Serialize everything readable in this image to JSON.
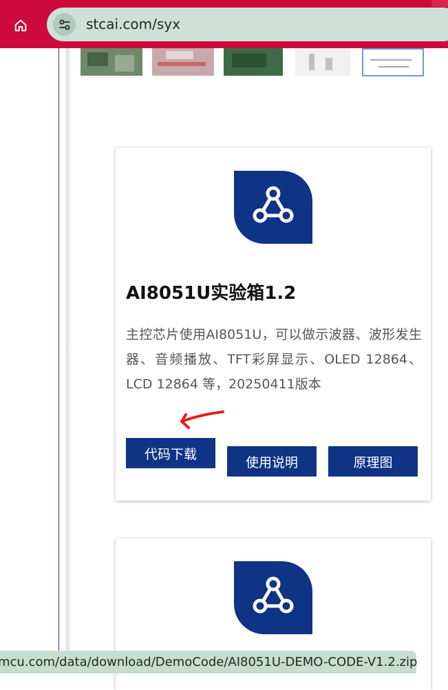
{
  "browser": {
    "url": "stcai.com/syx",
    "home_icon": "home-icon",
    "site_settings_icon": "tune-icon",
    "chrome_color": "#cc0a3c",
    "urlbar_color": "#cfe0d8"
  },
  "cards": [
    {
      "icon": "webhook-icon",
      "title": "AI8051U实验箱1.2",
      "description": "主控芯片使用AI8051U，可以做示波器、波形发生器、音频播放、TFT彩屏显示、OLED 12864、LCD 12864 等，20250411版本",
      "buttons": {
        "download": "代码下载",
        "manual": "使用说明",
        "schematic": "原理图"
      }
    },
    {
      "icon": "webhook-icon"
    }
  ],
  "status": {
    "link_preview": "mcu.com/data/download/DemoCode/AI8051U-DEMO-CODE-V1.2.zip"
  },
  "colors": {
    "brand_blue": "#0f3385",
    "annotation_red": "#e0201c"
  }
}
